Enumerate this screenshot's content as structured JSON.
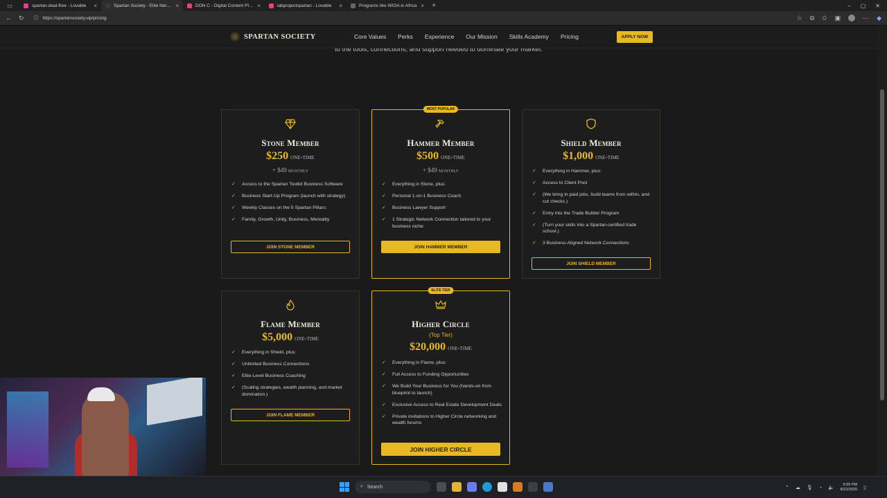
{
  "browser": {
    "tabs": [
      {
        "title": "spartan-deal-flow - Lovable",
        "color": "#e0418a",
        "active": false
      },
      {
        "title": "Spartan Society - Elite Networking",
        "color": "#3a3a3a",
        "active": true
      },
      {
        "title": "DON C - Digital Content Platform",
        "color": "#e0418a",
        "active": false
      },
      {
        "title": "labprojectspartan - Lovable",
        "color": "#e0418a",
        "active": false
      },
      {
        "title": "Programs like WIOA in Africa",
        "color": "#666666",
        "active": false
      }
    ],
    "url": "https://spartansociety.vip/pricing"
  },
  "site": {
    "brand": "SPARTAN SOCIETY",
    "nav": [
      "Core Values",
      "Perks",
      "Experience",
      "Our Mission",
      "Skills Academy",
      "Pricing"
    ],
    "apply_label": "APPLY NOW",
    "intro_text": "to the tools, connections, and support needed to dominate your market."
  },
  "plans": [
    {
      "name": "Stone Member",
      "icon": "diamond-icon",
      "badge": "",
      "subtitle": "",
      "price": "$250",
      "price_unit": "one-time",
      "monthly": "+ $49",
      "monthly_unit": "monthly",
      "features": [
        "Access to the Spartan Toolkit Business Software",
        "Business Start-Up Program (launch with strategy)",
        "Weekly Classes on the 5 Spartan Pillars:",
        "Family, Growth, Unity, Business, Mentality"
      ],
      "cta": "JOIN STONE MEMBER",
      "cta_style": "outline"
    },
    {
      "name": "Hammer Member",
      "icon": "hammer-icon",
      "badge": "MOST POPULAR",
      "subtitle": "",
      "price": "$500",
      "price_unit": "one-time",
      "monthly": "+ $49",
      "monthly_unit": "monthly",
      "features": [
        "Everything in Stone, plus:",
        "Personal 1-on-1 Business Coach",
        "Business Lawyer Support",
        "1 Strategic Network Connection tailored to your business niche"
      ],
      "cta": "JOIN HAMMER MEMBER",
      "cta_style": "solid"
    },
    {
      "name": "Shield Member",
      "icon": "shield-icon",
      "badge": "",
      "subtitle": "",
      "price": "$1,000",
      "price_unit": "one-time",
      "monthly": "",
      "monthly_unit": "",
      "features": [
        "Everything in Hammer, plus:",
        "Access to Client Pool",
        "(We bring in paid jobs, build teams from within, and cut checks.)",
        "Entry into the Trade Builder Program",
        "(Turn your skills into a Spartan-certified trade school.)",
        "3 Business-Aligned Network Connections"
      ],
      "cta": "JOIN SHIELD MEMBER",
      "cta_style": "outline"
    },
    {
      "name": "Flame Member",
      "icon": "flame-icon",
      "badge": "",
      "subtitle": "",
      "price": "$5,000",
      "price_unit": "one-time",
      "monthly": "",
      "monthly_unit": "",
      "features": [
        "Everything in Shield, plus:",
        "Unlimited Business Connections",
        "Elite-Level Business Coaching",
        "(Scaling strategies, wealth planning, and market domination.)"
      ],
      "cta": "JOIN FLAME MEMBER",
      "cta_style": "outline"
    },
    {
      "name": "Higher Circle",
      "icon": "crown-icon",
      "badge": "ELITE TIER",
      "subtitle": "(Top Tier)",
      "price": "$20,000",
      "price_unit": "one-time",
      "monthly": "",
      "monthly_unit": "",
      "features": [
        "Everything in Flame, plus:",
        "Full Access to Funding Opportunities",
        "We Build Your Business for You (hands-on from blueprint to launch)",
        "Exclusive Access to Real Estate Development Deals",
        "Private invitations to Higher Circle networking and wealth forums"
      ],
      "cta": "JOIN HIGHER CIRCLE",
      "cta_style": "solid"
    }
  ],
  "taskbar": {
    "search_label": "Search",
    "time": "6:55 PM",
    "date": "8/22/2025"
  },
  "colors": {
    "accent": "#e8b923",
    "background": "#1a1a1a"
  }
}
